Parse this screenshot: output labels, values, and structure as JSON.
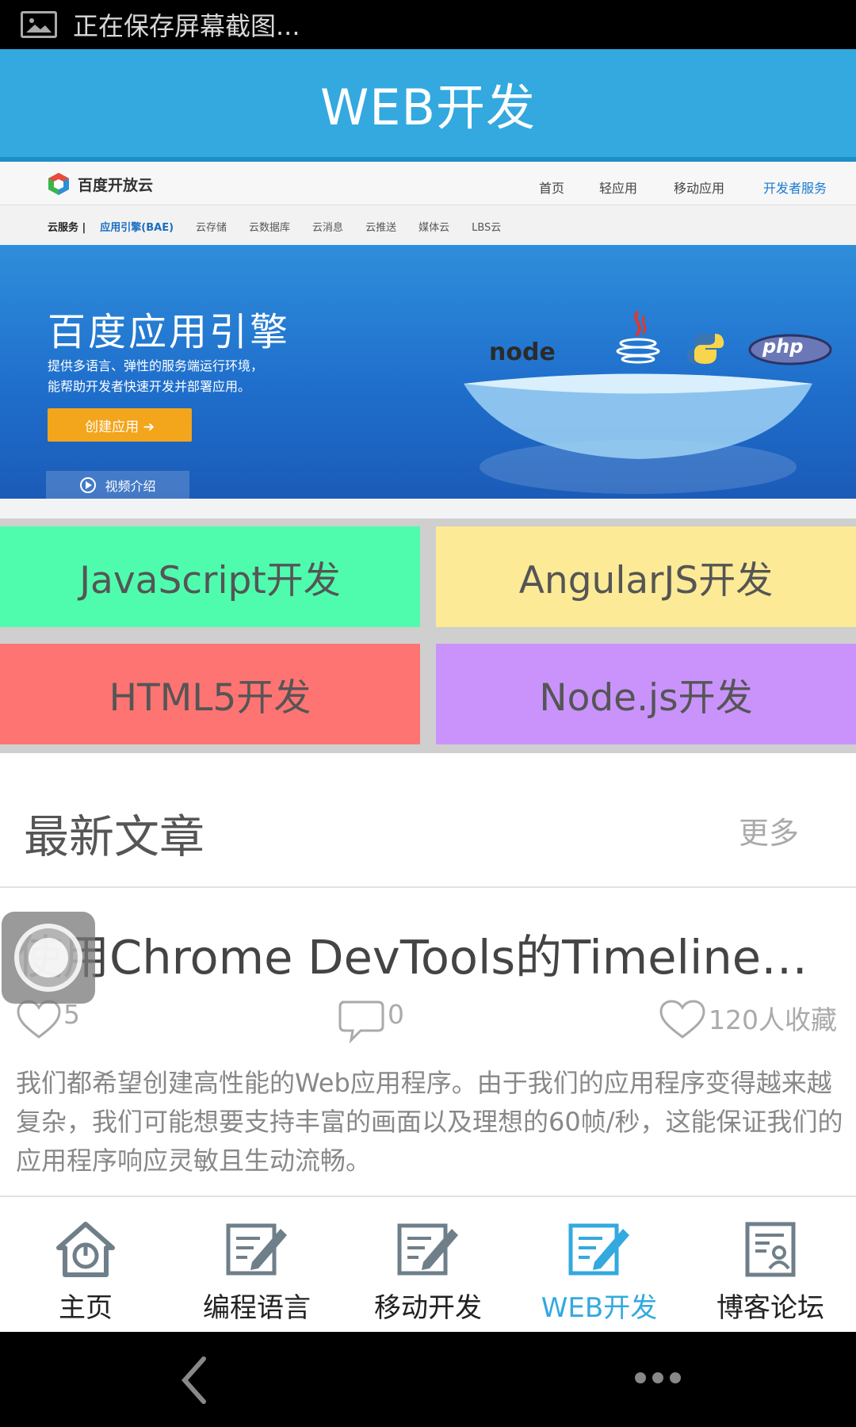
{
  "status_bar": {
    "text": "正在保存屏幕截图...",
    "icon": "image-icon"
  },
  "header": {
    "title": "WEB开发"
  },
  "banner": {
    "logo_text": "百度开放云",
    "nav": [
      "首页",
      "轻应用",
      "移动应用",
      "开发者服务"
    ],
    "subnav": [
      "云服务 |",
      "应用引擎(BAE)",
      "云存储",
      "云数据库",
      "云消息",
      "云推送",
      "媒体云",
      "LBS云"
    ],
    "headline": "百度应用引擎",
    "desc_line1": "提供多语言、弹性的服务端运行环境，",
    "desc_line2": "能帮助开发者快速开发并部署应用。",
    "create_button": "创建应用 ➔",
    "video_button": "视频介绍",
    "tech_node": "node",
    "tech_php": "php",
    "accent": "#f3a51b"
  },
  "categories": [
    {
      "label": "JavaScript开发",
      "color": "#4ffcae"
    },
    {
      "label": "AngularJS开发",
      "color": "#fdea96"
    },
    {
      "label": "HTML5开发",
      "color": "#fe7472"
    },
    {
      "label": "Node.js开发",
      "color": "#c993fb"
    }
  ],
  "latest": {
    "title": "最新文章",
    "more": "更多"
  },
  "article": {
    "title": "使用Chrome DevTools的Timeline和Pr..",
    "likes": "5",
    "comments": "0",
    "favorites": "120人收藏",
    "body": "我们都希望创建高性能的Web应用程序。由于我们的应用程序变得越来越复杂，我们可能想要支持丰富的画面以及理想的60帧/秒，这能保证我们的应用程序响应灵敏且生动流畅。"
  },
  "tabs": [
    {
      "label": "主页",
      "icon": "home-icon"
    },
    {
      "label": "编程语言",
      "icon": "edit-icon"
    },
    {
      "label": "移动开发",
      "icon": "edit-icon"
    },
    {
      "label": "WEB开发",
      "icon": "edit-icon",
      "active": true
    },
    {
      "label": "博客论坛",
      "icon": "profile-card-icon"
    }
  ],
  "colors": {
    "primary": "#33a9df",
    "active_tab": "#33a9df"
  }
}
